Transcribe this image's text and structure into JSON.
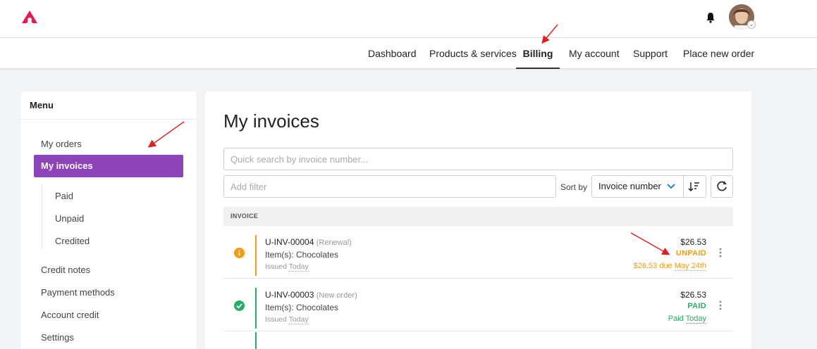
{
  "nav": {
    "items": [
      "Dashboard",
      "Products & services",
      "Billing",
      "My account",
      "Support",
      "Place new order"
    ],
    "active": "Billing"
  },
  "sidebar": {
    "title": "Menu",
    "items": {
      "orders": "My orders",
      "invoices": "My invoices",
      "paid": "Paid",
      "unpaid": "Unpaid",
      "credited": "Credited",
      "credit_notes": "Credit notes",
      "payment_methods": "Payment methods",
      "account_credit": "Account credit",
      "settings": "Settings"
    }
  },
  "main": {
    "title": "My invoices",
    "search_placeholder": "Quick search by invoice number...",
    "filter_placeholder": "Add filter",
    "sort_label": "Sort by",
    "sort_value": "Invoice number",
    "table_header": "INVOICE"
  },
  "invoices": [
    {
      "number": "U-INV-00004",
      "kind": "(Renewal)",
      "items": "Item(s): Chocolates",
      "issued_prefix": "Issued",
      "issued": "Today",
      "amount": "$26.53",
      "state": "UNPAID",
      "due_prefix": "$26.53 due",
      "due": "May 24th",
      "status_icon": "info-icon"
    },
    {
      "number": "U-INV-00003",
      "kind": "(New order)",
      "items": "Item(s): Chocolates",
      "issued_prefix": "Issued",
      "issued": "Today",
      "amount": "$26.53",
      "state": "PAID",
      "due_prefix": "Paid",
      "due": "Today",
      "status_icon": "check-circle-icon"
    }
  ],
  "colors": {
    "accent_purple": "#8e44b9",
    "unpaid_orange": "#f39c12",
    "paid_green": "#27ae60",
    "logo_pink": "#e8194b",
    "annotation_red": "#e02020"
  }
}
